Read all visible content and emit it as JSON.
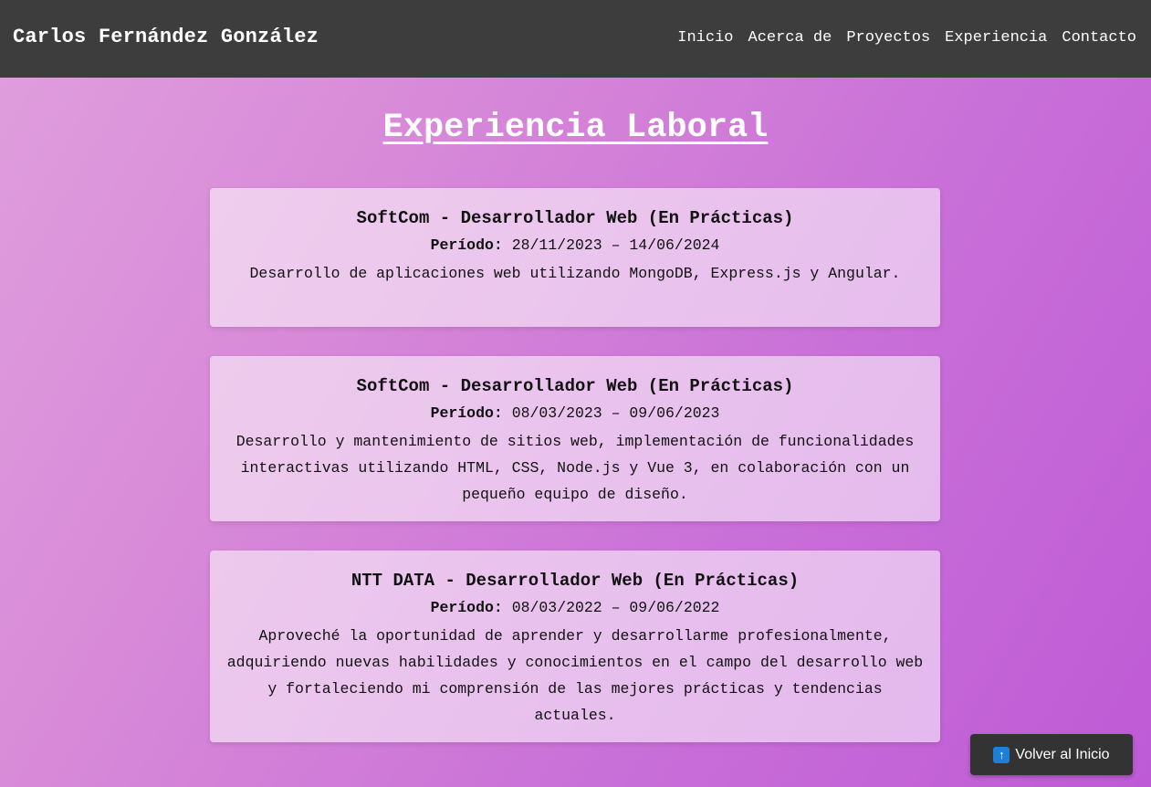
{
  "navbar": {
    "brand": "Carlos Fernández González",
    "links": [
      "Inicio",
      "Acerca de",
      "Proyectos",
      "Experiencia",
      "Contacto"
    ]
  },
  "page_title": "Experiencia Laboral",
  "period_label": "Período:",
  "experiences": [
    {
      "title": "SoftCom - Desarrollador Web (En Prácticas)",
      "period": "28/11/2023 – 14/06/2024",
      "description": "Desarrollo de aplicaciones web utilizando MongoDB, Express.js y Angular."
    },
    {
      "title": "SoftCom - Desarrollador Web (En Prácticas)",
      "period": "08/03/2023 – 09/06/2023",
      "description": "Desarrollo y mantenimiento de sitios web, implementación de funcionalidades interactivas utilizando HTML, CSS, Node.js y Vue 3, en colaboración con un pequeño equipo de diseño."
    },
    {
      "title": "NTT DATA - Desarrollador Web (En Prácticas)",
      "period": "08/03/2022 – 09/06/2022",
      "description": "Aproveché la oportunidad de aprender y desarrollarme profesionalmente, adquiriendo nuevas habilidades y conocimientos en el campo del desarrollo web y fortaleciendo mi comprensión de las mejores prácticas y tendencias actuales."
    }
  ],
  "back_button": {
    "icon": "up-arrow-icon",
    "label": "Volver al Inicio"
  },
  "colors": {
    "navbar_bg": "#3d3d3d",
    "background_start": "#df9fdd",
    "background_end": "#be5ad6",
    "button_bg": "#333333",
    "icon_blue": "#1f7fd6"
  }
}
